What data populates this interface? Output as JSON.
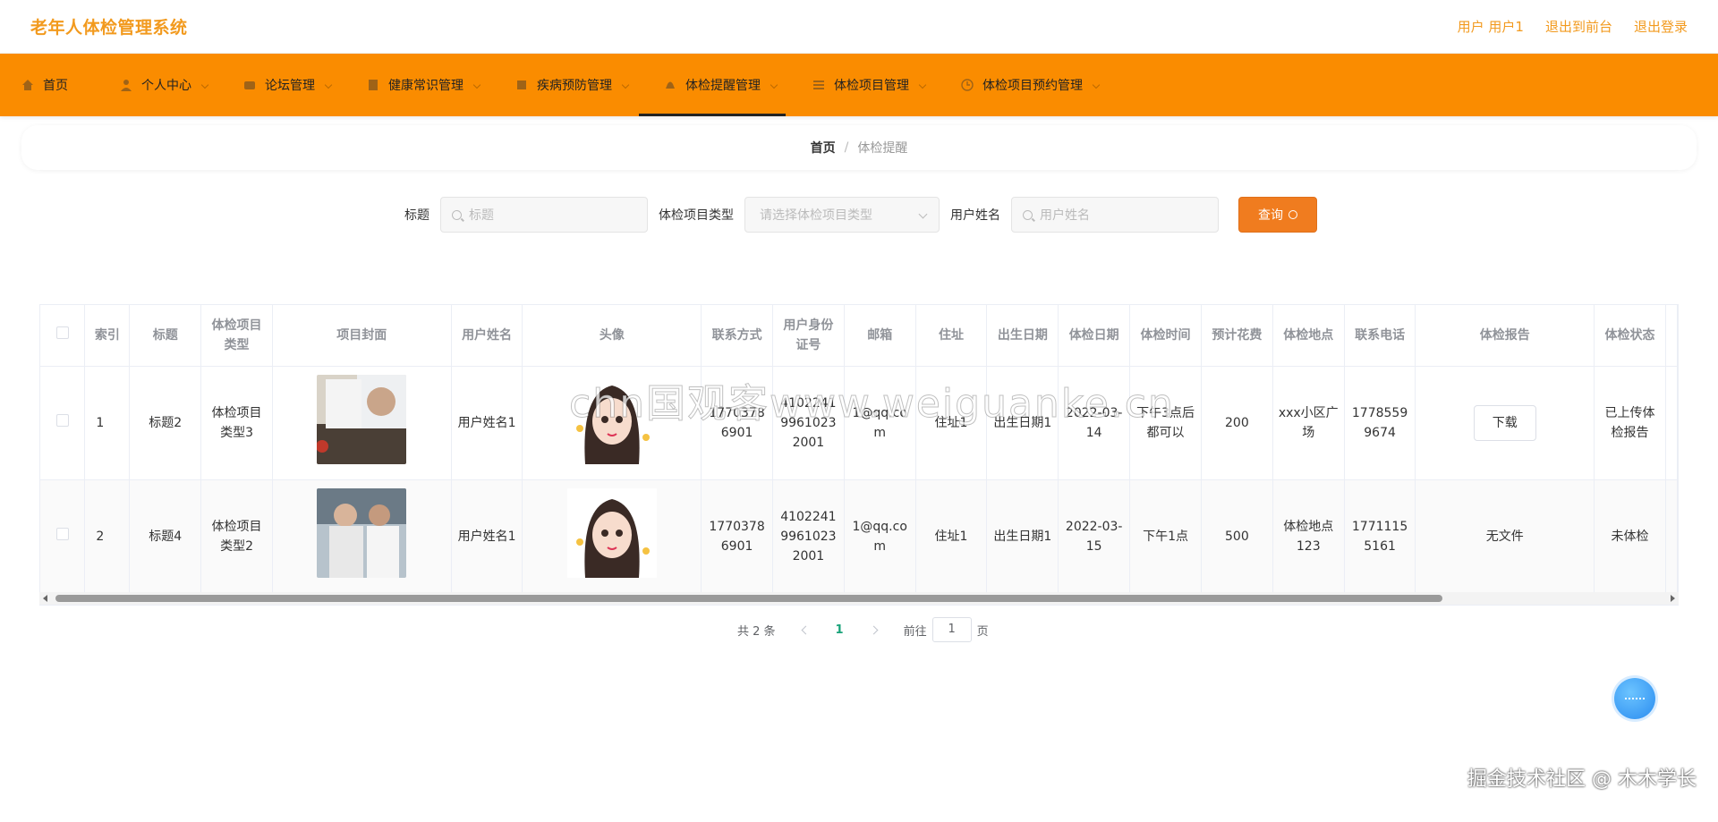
{
  "app": {
    "title": "老年人体检管理系统"
  },
  "header": {
    "user_label": "用户 用户1",
    "front_link": "退出到前台",
    "logout": "退出登录"
  },
  "nav": [
    {
      "label": "首页",
      "icon": "home-icon"
    },
    {
      "label": "个人中心",
      "icon": "user-icon"
    },
    {
      "label": "论坛管理",
      "icon": "forum-icon"
    },
    {
      "label": "健康常识管理",
      "icon": "book-icon"
    },
    {
      "label": "疾病预防管理",
      "icon": "shield-icon"
    },
    {
      "label": "体检提醒管理",
      "icon": "bell-icon",
      "active": true
    },
    {
      "label": "体检项目管理",
      "icon": "list-icon"
    },
    {
      "label": "体检项目预约管理",
      "icon": "clock-icon"
    }
  ],
  "breadcrumb": {
    "home": "首页",
    "sep": "/",
    "current": "体检提醒"
  },
  "search": {
    "title_label": "标题",
    "title_placeholder": "标题",
    "type_label": "体检项目类型",
    "type_placeholder": "请选择体检项目类型",
    "name_label": "用户姓名",
    "name_placeholder": "用户姓名",
    "query_button": "查询"
  },
  "table": {
    "headers": [
      "索引",
      "标题",
      "体检项目类型",
      "项目封面",
      "用户姓名",
      "头像",
      "联系方式",
      "用户身份证号",
      "邮箱",
      "住址",
      "出生日期",
      "体检日期",
      "体检时间",
      "预计花费",
      "体检地点",
      "联系电话",
      "体检报告",
      "体检状态"
    ],
    "rows": [
      {
        "index": "1",
        "title": "标题2",
        "type": "体检项目类型3",
        "name": "用户姓名1",
        "phone": "17703786901",
        "idcard": "410224199610232001",
        "email": "1@qq.com",
        "address": "住址1",
        "birth": "出生日期1",
        "date": "2022-03-14",
        "time": "下午3点后都可以",
        "cost": "200",
        "place": "xxx小区广场",
        "tel": "17785599674",
        "report": "下载",
        "status": "已上传体检报告"
      },
      {
        "index": "2",
        "title": "标题4",
        "type": "体检项目类型2",
        "name": "用户姓名1",
        "phone": "17703786901",
        "idcard": "410224199610232001",
        "email": "1@qq.com",
        "address": "住址1",
        "birth": "出生日期1",
        "date": "2022-03-15",
        "time": "下午1点",
        "cost": "500",
        "place": "体检地点123",
        "tel": "17711155161",
        "report": "无文件",
        "status": "未体检"
      }
    ]
  },
  "pagination": {
    "total": "共 2 条",
    "current_page": "1",
    "goto_label": "前往",
    "goto_value": "1",
    "page_suffix": "页"
  },
  "watermarks": {
    "center": "chn国观客www.weiguanke.cn",
    "corner": "掘金技术社区 @ 木木学长"
  },
  "colors": {
    "brand": "#f29a1e",
    "nav_bg": "#fa8c00",
    "query_button": "#f07c1f",
    "page_active": "#1aa37a"
  }
}
